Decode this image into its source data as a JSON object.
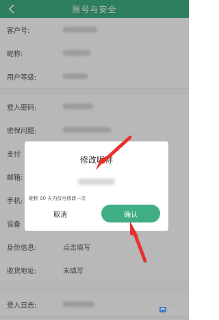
{
  "header": {
    "title": "账号与安全",
    "back_icon": "chevron-left-icon"
  },
  "rows": [
    {
      "label": "客户号:",
      "value": ""
    },
    {
      "label": "昵称:",
      "value": ""
    },
    {
      "label": "用户等级:",
      "value": ""
    },
    {
      "label": "登入密码:",
      "value": ""
    },
    {
      "label": "密保问题:",
      "value": ""
    },
    {
      "label": "支付",
      "value": ""
    },
    {
      "label": "邮箱:",
      "value": ""
    },
    {
      "label": "手机:",
      "value": ""
    },
    {
      "label": "设备",
      "value": ""
    },
    {
      "label": "身份信息:",
      "value": "点击填写"
    },
    {
      "label": "收货地址:",
      "value": "未填写"
    },
    {
      "label": "登入日志:",
      "value": ""
    }
  ],
  "dialog": {
    "title": "修改昵称",
    "hint": "昵称 90 天内仅可修改一次",
    "cancel_label": "取消",
    "confirm_label": "确认"
  },
  "colors": {
    "accent": "#3fae84",
    "arrow": "#e8312f"
  }
}
